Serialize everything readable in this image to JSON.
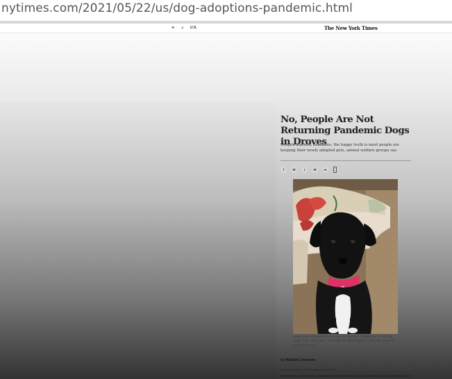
{
  "browser": {
    "url": "nytimes.com/2021/05/22/us/dog-adoptions-pandemic.html"
  },
  "topnav": {
    "menu_icon": "≡",
    "search_icon": "⌕",
    "section_label": "U.S.",
    "masthead": "The New York Times"
  },
  "article": {
    "headline": "No, People Are Not Returning Pandemic Dogs in Droves",
    "summary": "Despite alarmist headlines, the happy truth is most people are keeping their newly adopted pets, animal welfare groups say.",
    "share_icons": [
      "f",
      "✉",
      "t",
      "✉",
      "➦"
    ],
    "image": {
      "caption": "Louie was adopted in October by Jeremy Thompson of Spring Lake, N.J., who said, “I would be distraught if I felt the need to return my dog.”",
      "credit": "Jeremy Thompson"
    },
    "byline_prefix": "By",
    "author": "Michael Levenson",
    "dates": "Published May 22, 2021    Updated May 25, 2021",
    "body_start": "When the coronavirus pandemic forced millions of Americans to stay home last year, many took the opportunity to adopt a new pet."
  },
  "colors": {
    "headline": "#222222",
    "dog": "#111111",
    "collar": "#e0306a"
  }
}
